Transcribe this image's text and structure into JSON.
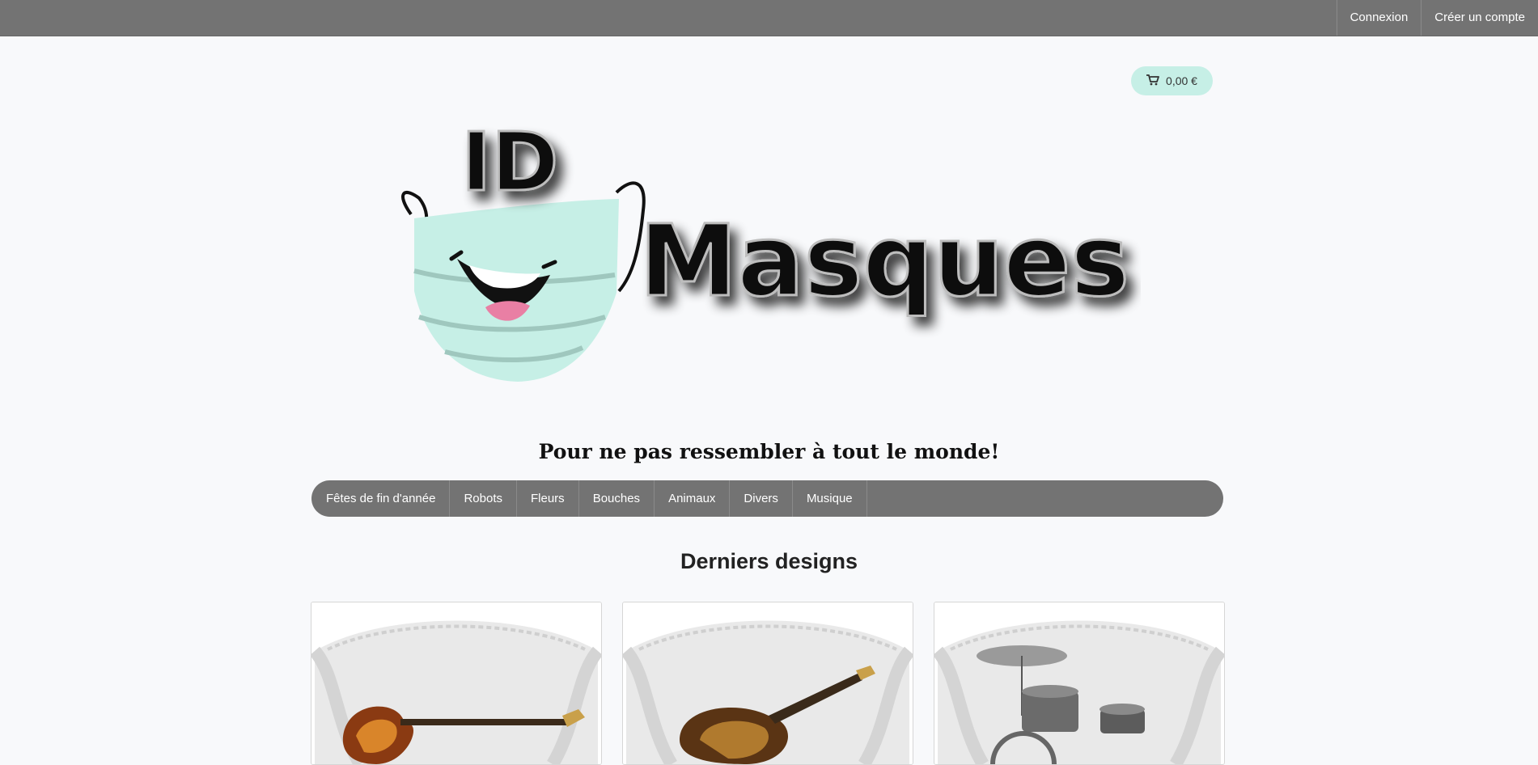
{
  "topbar": {
    "login_label": "Connexion",
    "register_label": "Créer un compte"
  },
  "cart": {
    "icon": "cart-icon",
    "amount": "0,00 €"
  },
  "logo": {
    "text_top": "ID",
    "text_main": "Masques",
    "mask_color": "#c6efe6"
  },
  "tagline": "Pour ne pas ressembler à tout le monde!",
  "nav": {
    "items": [
      {
        "label": "Fêtes de fin d'année"
      },
      {
        "label": "Robots"
      },
      {
        "label": "Fleurs"
      },
      {
        "label": "Bouches"
      },
      {
        "label": "Animaux"
      },
      {
        "label": "Divers"
      },
      {
        "label": "Musique"
      }
    ]
  },
  "latest": {
    "title": "Derniers designs",
    "products": [
      {
        "image": "mask-bass-guitar"
      },
      {
        "image": "mask-electric-guitar"
      },
      {
        "image": "mask-drum-kit"
      }
    ]
  },
  "colors": {
    "bar": "#737373",
    "accent": "#c6efe6",
    "background": "#f8f9fb"
  }
}
